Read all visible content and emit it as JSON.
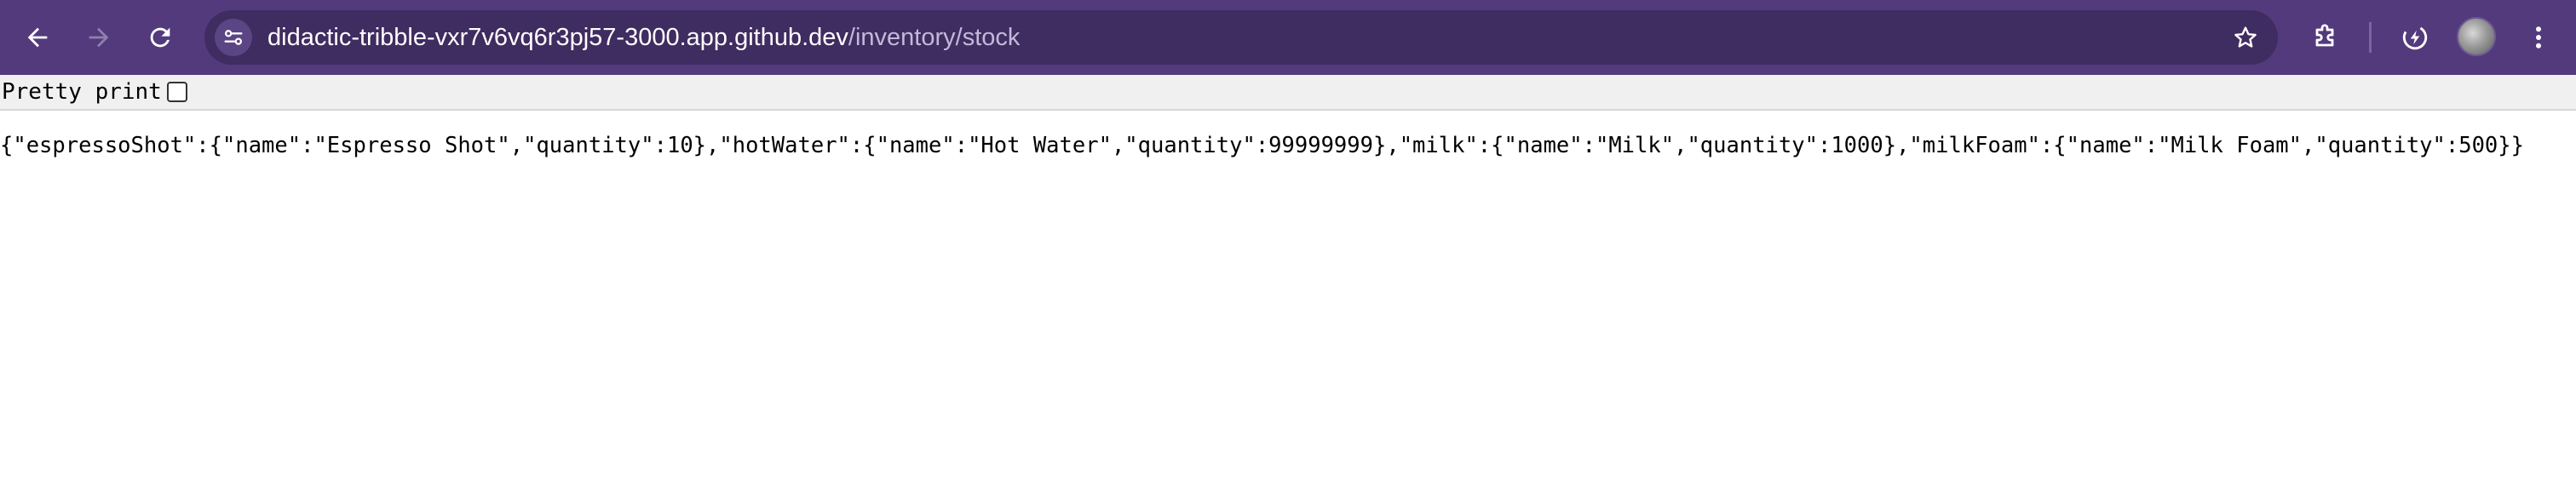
{
  "browser": {
    "url_host": "didactic-tribble-vxr7v6vq6r3pj57-3000.app.github.dev",
    "url_path": "/inventory/stock",
    "icons": {
      "back": "back-arrow-icon",
      "forward": "forward-arrow-icon",
      "reload": "reload-icon",
      "site_info": "tune-icon",
      "bookmark": "star-icon",
      "extensions": "puzzle-icon",
      "performance": "lightning-icon",
      "profile": "avatar",
      "menu": "three-dots-icon"
    },
    "colors": {
      "toolbar": "#533a7c",
      "omnibox": "#3f2c60"
    }
  },
  "viewer": {
    "pretty_print_label": "Pretty print",
    "pretty_print_checked": false,
    "raw_json": "{\"espressoShot\":{\"name\":\"Espresso Shot\",\"quantity\":10},\"hotWater\":{\"name\":\"Hot Water\",\"quantity\":99999999},\"milk\":{\"name\":\"Milk\",\"quantity\":1000},\"milkFoam\":{\"name\":\"Milk Foam\",\"quantity\":500}}"
  }
}
